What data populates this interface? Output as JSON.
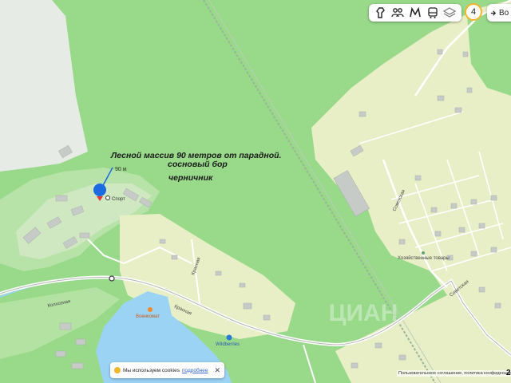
{
  "annotations": {
    "line1": "Лесной массив  90 метров от парадной.",
    "line2": "сосновый бор",
    "line3": "черничник"
  },
  "labels": {
    "distance": "90 м",
    "marker": "Спорт",
    "wildberries": "Wildberries",
    "military": "Военкомат",
    "street_krasnaya": "Красная",
    "street_krasnaya2": "Красная",
    "street_kolhoznaya": "Колхозная",
    "street_sovetskaya": "Советская",
    "street_sovetskaya2": "Советская",
    "shop": "Хозяйственные товары"
  },
  "toolbar": {
    "zoom_level": "4",
    "login_label": "Во"
  },
  "icons": [
    "panorama-icon",
    "people-icon",
    "metro-icon",
    "transport-icon",
    "layers-icon"
  ],
  "cookie": {
    "text": "Мы используем cookies",
    "link": "подробнее",
    "close": "✕"
  },
  "attribution": "Пользовательское соглашение, политика конфиденциальности",
  "corner_number": "2",
  "watermark": "ЦИАН",
  "colors": {
    "forest": "#98d98a",
    "forest_light": "#b3e2a3",
    "residential": "#e8efc6",
    "water": "#9bd3f5",
    "road": "#ffffff",
    "buildings": "#c7cbc8",
    "marker": "#1b6ae0",
    "annotation_text": "#1a1a1a"
  }
}
